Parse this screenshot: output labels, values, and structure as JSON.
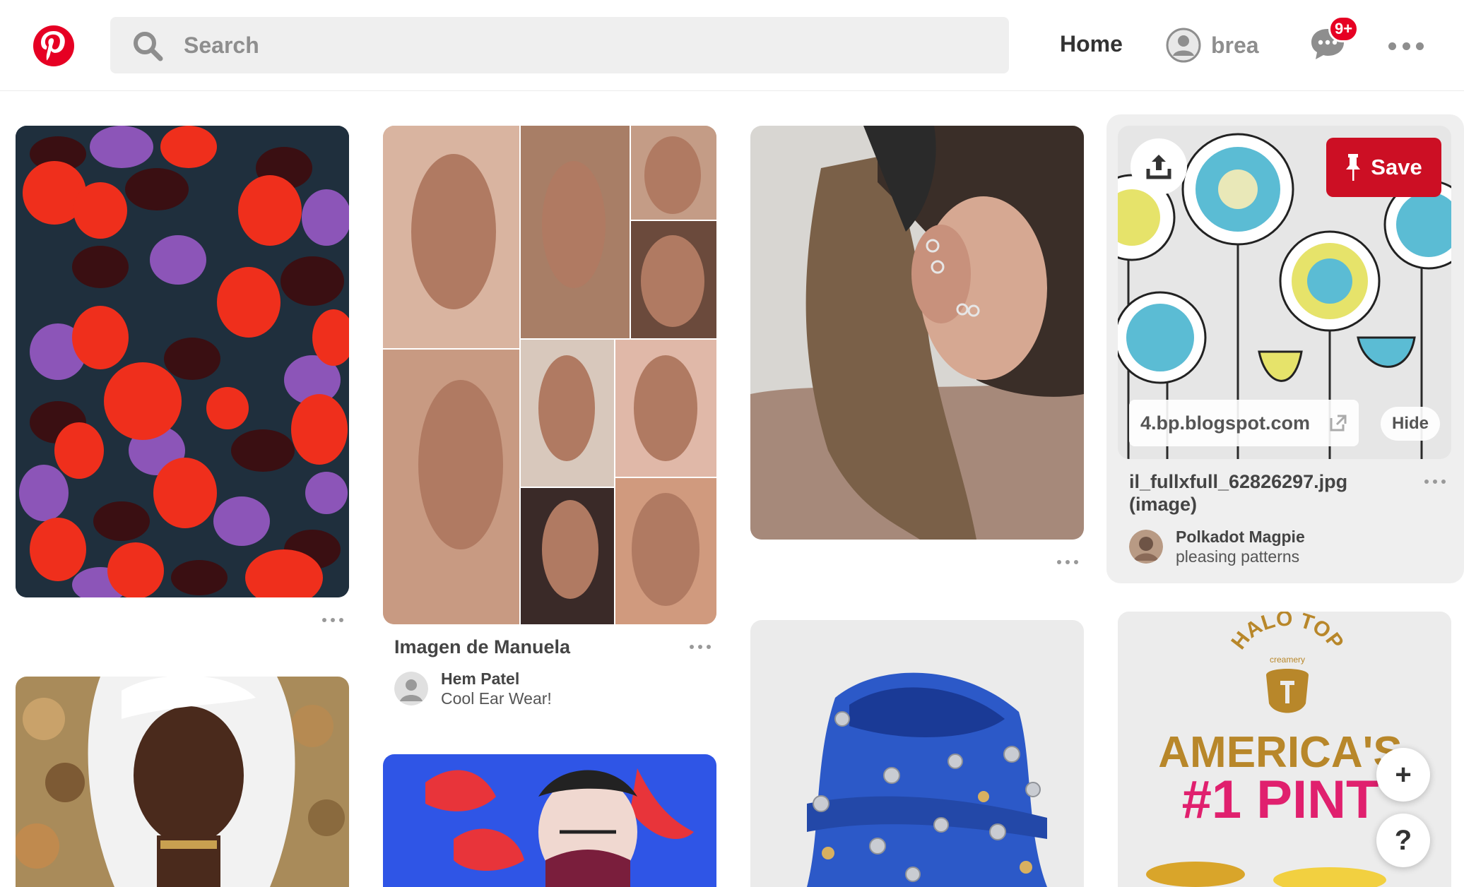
{
  "header": {
    "search_placeholder": "Search",
    "home_label": "Home",
    "profile_name": "brea",
    "messages_badge": "9+",
    "brand_color": "#e60023"
  },
  "pins": {
    "manuela": {
      "title": "Imagen de Manuela",
      "user": "Hem Patel",
      "board": "Cool Ear Wear!"
    },
    "flowers": {
      "domain": "4.bp.blogspot.com",
      "title_line1": "il_fullxfull_62826297.jpg",
      "title_line2": "(image)",
      "user": "Polkadot Magpie",
      "board": "pleasing patterns",
      "save_label": "Save",
      "hide_label": "Hide"
    },
    "halo": {
      "brand": "HALO TOP",
      "sub": "creamery",
      "headline1": "AMERICA'S",
      "headline2": "#1 PINT"
    }
  },
  "fabs": {
    "add_label": "+",
    "help_label": "?"
  }
}
